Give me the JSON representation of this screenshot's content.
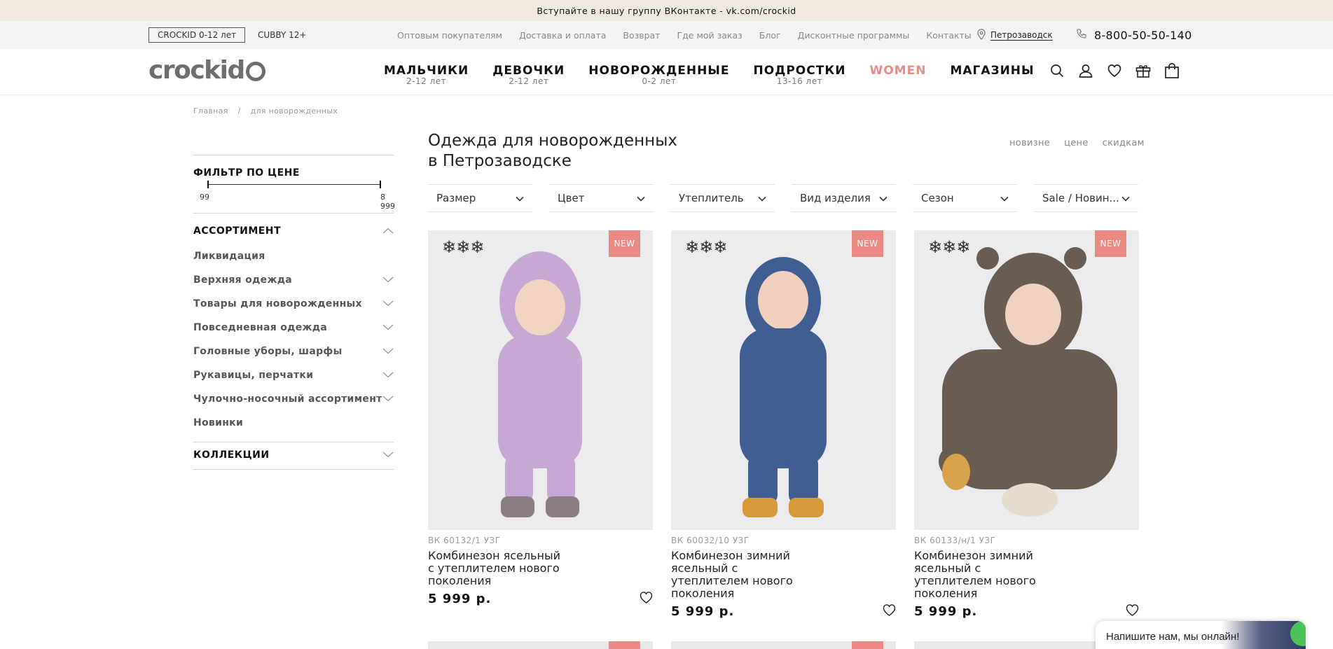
{
  "promo": "Вступайте в нашу группу ВКонтакте - vk.com/crockid",
  "brands": [
    "CROCKID 0-12 лет",
    "CUBBY 12+"
  ],
  "top_links": [
    "Оптовым покупателям",
    "Доставка и оплата",
    "Возврат",
    "Где мой заказ",
    "Блог",
    "Дисконтные программы",
    "Контакты"
  ],
  "city": "Петрозаводск",
  "phone": "8-800-50-50-140",
  "logo_text": "crockid",
  "nav": [
    {
      "label": "МАЛЬЧИКИ",
      "sub": "2-12 лет"
    },
    {
      "label": "ДЕВОЧКИ",
      "sub": "2-12 лет"
    },
    {
      "label": "НОВОРОЖДЕННЫЕ",
      "sub": "0-2 лет"
    },
    {
      "label": "ПОДРОСТКИ",
      "sub": "13-16 лет"
    },
    {
      "label": "WOMEN",
      "sub": ""
    },
    {
      "label": "МАГАЗИНЫ",
      "sub": ""
    }
  ],
  "nav_icons": [
    "search-icon",
    "user-icon",
    "heart-icon",
    "gift-icon",
    "bag-icon"
  ],
  "breadcrumbs": {
    "home": "Главная",
    "sep": "/",
    "current": "для новорожденных"
  },
  "filter": {
    "price_title": "ФИЛЬТР ПО ЦЕНЕ",
    "price_min": "99",
    "price_max": "8 999",
    "assortment_title": "АССОРТИМЕНТ",
    "categories": [
      {
        "label": "Ликвидация",
        "expand": false
      },
      {
        "label": "Верхняя одежда",
        "expand": true
      },
      {
        "label": "Товары для новорожденных",
        "expand": true
      },
      {
        "label": "Повседневная одежда",
        "expand": true
      },
      {
        "label": "Головные уборы, шарфы",
        "expand": true
      },
      {
        "label": "Рукавицы, перчатки",
        "expand": true
      },
      {
        "label": "Чулочно-носочный ассортимент",
        "expand": true
      },
      {
        "label": "Новинки",
        "expand": false
      }
    ],
    "collections_title": "КОЛЛЕКЦИИ"
  },
  "page_title": "Одежда для новорожденных в Петрозаводске",
  "sort_options": [
    "новизне",
    "цене",
    "скидкам"
  ],
  "filter_selects": [
    "Размер",
    "Цвет",
    "Утеплитель",
    "Вид изделия",
    "Сезон",
    "Sale / Новин..."
  ],
  "products": [
    {
      "article": "ВК 60132/1 УЗГ",
      "name": "Комбинезон ясельный с утеплителем нового поколения",
      "price": "5 999 р.",
      "badge": "NEW",
      "snow": "❄❄❄",
      "photo_color": "#c7a8d4"
    },
    {
      "article": "ВК 60032/10 УЗГ",
      "name": "Комбинезон зимний ясельный с утеплителем нового поколения",
      "price": "5 999 р.",
      "badge": "NEW",
      "snow": "❄❄❄",
      "photo_color": "#3f5f93"
    },
    {
      "article": "ВК 60133/н/1 УЗГ",
      "name": "Комбинезон зимний ясельный с утеплителем нового поколения",
      "price": "5 999 р.",
      "badge": "NEW",
      "snow": "❄❄❄",
      "photo_color": "#6b5c52"
    }
  ],
  "chat": "Напишите нам, мы онлайн!"
}
